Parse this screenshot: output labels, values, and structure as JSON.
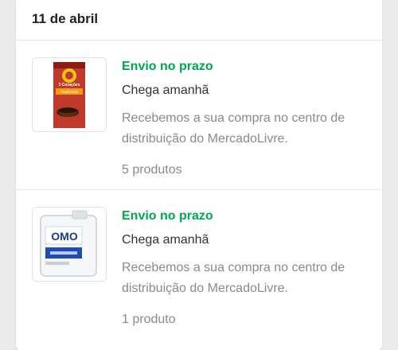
{
  "date_header": "11 de abril",
  "shipments": [
    {
      "status": "Envio no prazo",
      "status_color": "#00a650",
      "arrival": "Chega amanhã",
      "description": "Recebemos a sua compra no centro de distribuição do MercadoLivre.",
      "count": "5 produtos",
      "image": {
        "icon": "coffee-package-icon",
        "brand_text": "3 Corações",
        "sub_text": "Tradicional"
      }
    },
    {
      "status": "Envio no prazo",
      "status_color": "#00a650",
      "arrival": "Chega amanhã",
      "description": "Recebemos a sua compra no centro de distribuição do MercadoLivre.",
      "count": "1 produto",
      "image": {
        "icon": "detergent-jug-icon",
        "brand_text": "OMO"
      }
    }
  ]
}
